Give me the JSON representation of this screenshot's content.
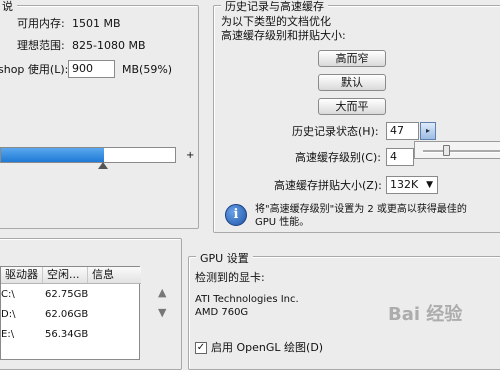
{
  "memory": {
    "section_title": "说",
    "available_label": "可用内存:",
    "available_value": "1501 MB",
    "ideal_label": "理想范围:",
    "ideal_value": "825-1080 MB",
    "usage_label": "shop 使用(L):",
    "usage_value": "900",
    "usage_unit": "MB(59%)",
    "slider_fraction": 0.59,
    "plus_mark": "+"
  },
  "history_cache": {
    "title": "历史记录与高速缓存",
    "desc_line1": "为以下类型的文档优化",
    "desc_line2": "高速缓存级别和拼贴大小:",
    "btn_tall_thin": "高而窄",
    "btn_default": "默认",
    "btn_large_flat": "大而平",
    "history_states_label": "历史记录状态(H):",
    "history_states_value": "47",
    "cache_levels_label": "高速缓存级别(C):",
    "cache_levels_value": "4",
    "tile_size_label": "高速缓存拼贴大小(Z):",
    "tile_size_value": "132K",
    "info_text_line1": "将\"高速缓存级别\"设置为 2 或更高以获得最佳的",
    "info_text_line2": "GPU 性能。",
    "spin_arrow": "▸",
    "select_arrow": "▼",
    "info_icon_glyph": "i"
  },
  "scratch": {
    "columns": [
      "驱动器",
      "空闲...",
      "信息"
    ],
    "rows": [
      {
        "drive": "C:\\",
        "free": "62.75GB"
      },
      {
        "drive": "D:\\",
        "free": "62.06GB"
      },
      {
        "drive": "E:\\",
        "free": "56.34GB"
      }
    ],
    "up_arrow": "▲",
    "down_arrow": "▼"
  },
  "gpu": {
    "title": "GPU 设置",
    "detected_label": "检测到的显卡:",
    "vendor": "ATI Technologies Inc.",
    "model": "AMD 760G",
    "opengl_label": "启用 OpenGL 绘图(D)",
    "opengl_checked": true,
    "check_glyph": "✓"
  },
  "watermark": "Bai 经验"
}
